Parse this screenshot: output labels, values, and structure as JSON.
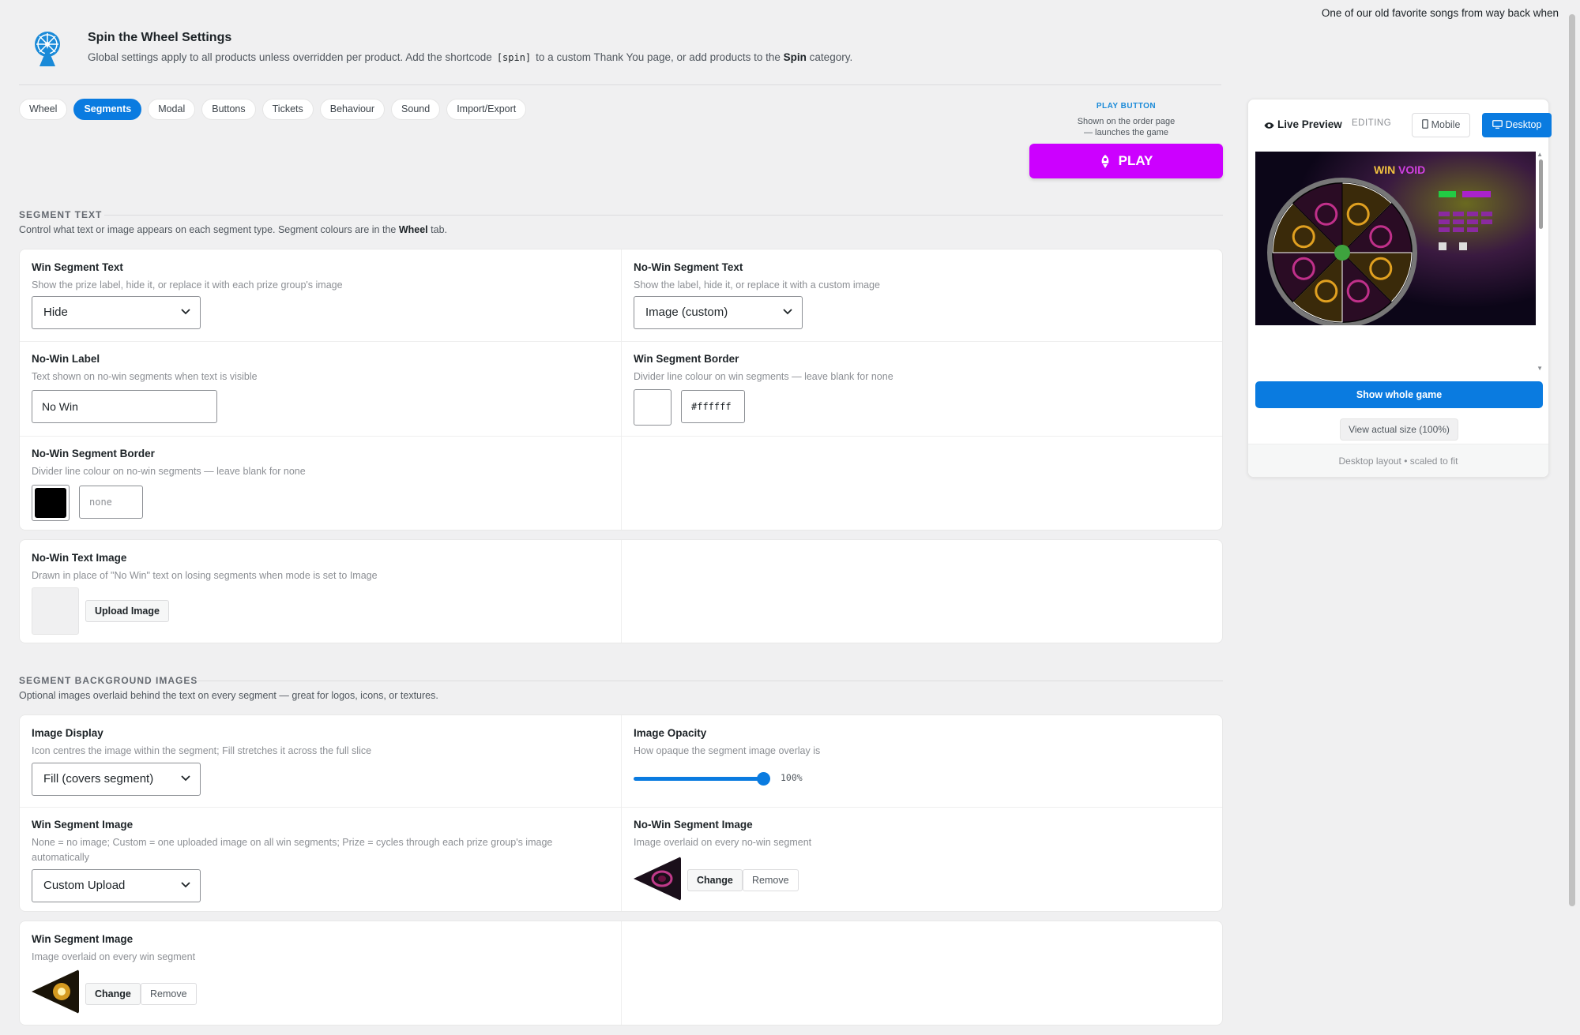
{
  "top_note": "One of our old favorite songs from way back when",
  "header": {
    "title": "Spin the Wheel Settings",
    "desc_before": "Global settings apply to all products unless overridden per product. Add the shortcode",
    "shortcode": "[spin]",
    "desc_middle": "to a custom Thank You page, or add products to the",
    "category": "Spin",
    "desc_after": "category."
  },
  "tabs": [
    "Wheel",
    "Segments",
    "Modal",
    "Buttons",
    "Tickets",
    "Behaviour",
    "Sound",
    "Import/Export"
  ],
  "active_tab": "Segments",
  "play_button": {
    "heading": "PLAY BUTTON",
    "sub1": "Shown on the order page",
    "sub2": "— launches the game",
    "label": "PLAY",
    "color": "#cc00ff"
  },
  "segment_text": {
    "title": "SEGMENT TEXT",
    "desc_before": "Control what text or image appears on each segment type. Segment colours are in the",
    "desc_bold": "Wheel",
    "desc_after": "tab.",
    "win_text": {
      "label": "Win Segment Text",
      "help": "Show the prize label, hide it, or replace it with each prize group's image",
      "value": "Hide"
    },
    "nowin_text": {
      "label": "No-Win Segment Text",
      "help": "Show the label, hide it, or replace it with a custom image",
      "value": "Image (custom)"
    },
    "nowin_label": {
      "label": "No-Win Label",
      "help": "Text shown on no-win segments when text is visible",
      "value": "No Win"
    },
    "win_border": {
      "label": "Win Segment Border",
      "help": "Divider line colour on win segments — leave blank for none",
      "value": "#ffffff",
      "color": "#ffffff"
    },
    "nowin_border": {
      "label": "No-Win Segment Border",
      "help": "Divider line colour on no-win segments — leave blank for none",
      "placeholder": "none",
      "color": "#000000"
    },
    "nowin_image": {
      "label": "No-Win Text Image",
      "help": "Drawn in place of \"No Win\" text on losing segments when mode is set to Image",
      "button": "Upload Image"
    }
  },
  "segment_bg": {
    "title": "SEGMENT BACKGROUND IMAGES",
    "desc": "Optional images overlaid behind the text on every segment — great for logos, icons, or textures.",
    "image_display": {
      "label": "Image Display",
      "help": "Icon centres the image within the segment; Fill stretches it across the full slice",
      "value": "Fill (covers segment)"
    },
    "image_opacity": {
      "label": "Image Opacity",
      "help": "How opaque the segment image overlay is",
      "value": "100%",
      "level": 1.0
    },
    "win_image_mode": {
      "label": "Win Segment Image",
      "help": "None = no image; Custom = one uploaded image on all win segments; Prize = cycles through each prize group's image automatically",
      "value": "Custom Upload"
    },
    "nowin_image": {
      "label": "No-Win Segment Image",
      "help": "Image overlaid on every no-win segment",
      "change": "Change",
      "remove": "Remove"
    },
    "win_image": {
      "label": "Win Segment Image",
      "help": "Image overlaid on every win segment",
      "change": "Change",
      "remove": "Remove"
    }
  },
  "preview": {
    "title": "Live Preview",
    "editing": "EDITING",
    "mobile": "Mobile",
    "desktop": "Desktop",
    "show_whole": "Show whole game",
    "actual_size": "View actual size (100%)",
    "footer": "Desktop layout • scaled to fit"
  },
  "colors": {
    "accent": "#0a7be0",
    "play": "#cc00ff"
  },
  "icons": [
    "ferris-wheel-icon",
    "rocket-icon",
    "eye-icon",
    "mobile-icon",
    "desktop-icon",
    "chevron-down-icon"
  ]
}
